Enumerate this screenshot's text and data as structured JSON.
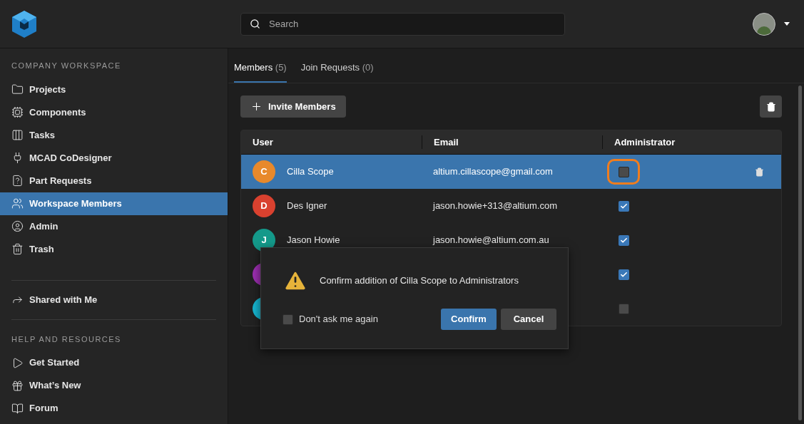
{
  "header": {
    "search": {
      "placeholder": "Search"
    }
  },
  "sidebar": {
    "sections": [
      {
        "title": "COMPANY WORKSPACE",
        "items": [
          {
            "label": "Projects",
            "selected": false
          },
          {
            "label": "Components",
            "selected": false
          },
          {
            "label": "Tasks",
            "selected": false
          },
          {
            "label": "MCAD CoDesigner",
            "selected": false
          },
          {
            "label": "Part Requests",
            "selected": false
          },
          {
            "label": "Workspace Members",
            "selected": true
          },
          {
            "label": "Admin",
            "selected": false
          },
          {
            "label": "Trash",
            "selected": false
          }
        ]
      },
      {
        "items": [
          {
            "label": "Shared with Me",
            "selected": false
          }
        ]
      },
      {
        "title": "HELP AND RESOURCES",
        "items": [
          {
            "label": "Get Started",
            "selected": false
          },
          {
            "label": "What’s New",
            "selected": false
          },
          {
            "label": "Forum",
            "selected": false
          }
        ]
      }
    ]
  },
  "tabs": [
    {
      "label": "Members",
      "count": "(5)",
      "selected": true
    },
    {
      "label": "Join Requests",
      "count": "(0)",
      "selected": false
    }
  ],
  "invite_button": "Invite Members",
  "table": {
    "columns": [
      "User",
      "Email",
      "Administrator"
    ],
    "rows": [
      {
        "initial": "C",
        "color": "#e8892b",
        "name": "Cilla Scope",
        "email": "altium.cillascope@gmail.com",
        "admin": false,
        "selected": true,
        "highlighted": true
      },
      {
        "initial": "D",
        "color": "#d9412f",
        "name": "Des Igner",
        "email": "jason.howie+313@altium.com",
        "admin": true,
        "selected": false,
        "highlighted": false
      },
      {
        "initial": "J",
        "color": "#14998a",
        "name": "Jason Howie",
        "email": "jason.howie@altium.com.au",
        "admin": true,
        "selected": false,
        "highlighted": false
      },
      {
        "color": "#9c2fb0",
        "admin": true,
        "selected": false,
        "highlighted": false
      },
      {
        "color": "#16b5d0",
        "admin": false,
        "selected": false,
        "highlighted": false
      }
    ]
  },
  "dialog": {
    "message": "Confirm addition of Cilla Scope to Administrators",
    "dont_ask": {
      "label": "Don't ask me again",
      "checked": false
    },
    "buttons": [
      {
        "label": "Confirm",
        "kind": "primary"
      },
      {
        "label": "Cancel",
        "kind": "secondary"
      }
    ]
  }
}
